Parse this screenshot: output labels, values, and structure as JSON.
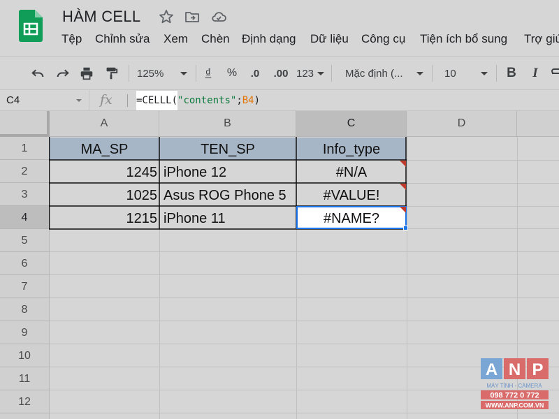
{
  "app": {
    "title": "HÀM CELL"
  },
  "menu": [
    "Tệp",
    "Chỉnh sửa",
    "Xem",
    "Chèn",
    "Định dạng",
    "Dữ liệu",
    "Công cụ",
    "Tiện ích bổ sung",
    "Trợ giú"
  ],
  "toolbar": {
    "zoom": "125%",
    "currency": "₫",
    "percent": "%",
    "decrease_decimal": ".0",
    "increase_decimal": ".00",
    "more_formats": "123",
    "font": "Mặc định (...",
    "font_size": "10",
    "bold": "B",
    "italic": "I"
  },
  "formula_bar": {
    "cell_ref": "C4",
    "fx": "fx",
    "formula_fn": "=CELLL(",
    "formula_str": "\"contents\"",
    "formula_sep": ";",
    "formula_ref": "B4",
    "formula_end": ")"
  },
  "columns": [
    "A",
    "B",
    "C",
    "D"
  ],
  "rows": [
    "1",
    "2",
    "3",
    "4",
    "5",
    "6",
    "7",
    "8",
    "9",
    "10",
    "11",
    "12"
  ],
  "table": {
    "headers": [
      "MA_SP",
      "TEN_SP",
      "Info_type"
    ],
    "data": [
      [
        "1245",
        "iPhone 12",
        "#N/A"
      ],
      [
        "1025",
        "Asus ROG Phone 5",
        "#VALUE!"
      ],
      [
        "1215",
        "iPhone 11",
        "#NAME?"
      ]
    ]
  },
  "watermark": {
    "letters": [
      "A",
      "N",
      "P"
    ],
    "line1": "MÁY TÍNH - CAMERA",
    "line2": "098 772 0 772",
    "line3": "WWW.ANP.COM.VN"
  },
  "colors": {
    "header_fill": "#a7b6c6",
    "error_marker": "#c0392b",
    "selection": "#1a73e8",
    "sheets_green": "#0f9d58"
  }
}
